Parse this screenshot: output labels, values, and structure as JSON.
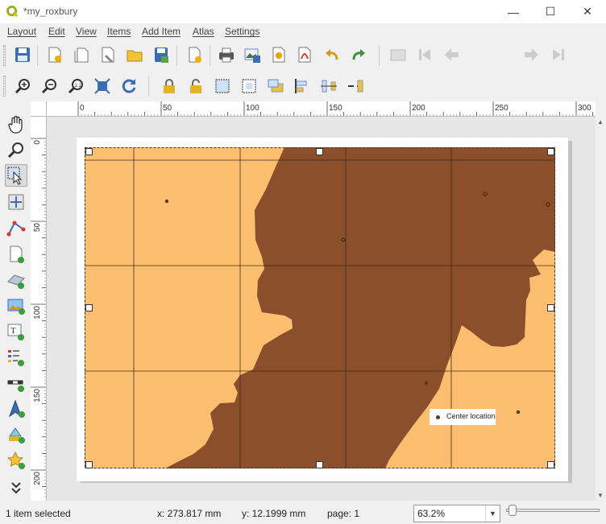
{
  "window": {
    "title": "*my_roxbury",
    "controls": {
      "minimize": "—",
      "maximize": "☐",
      "close": "✕"
    }
  },
  "menu": [
    "Layout",
    "Edit",
    "View",
    "Items",
    "Add Item",
    "Atlas",
    "Settings"
  ],
  "atlas_toolbar": {
    "page_value": "1",
    "more": "»"
  },
  "rulers": {
    "horizontal_labels": [
      "0",
      "50",
      "100",
      "150",
      "200",
      "250",
      "300"
    ],
    "vertical_labels": [
      "0",
      "50",
      "100",
      "150",
      "200"
    ]
  },
  "map": {
    "colors": {
      "light": "#fdbf6f",
      "dark": "#8b4f2b",
      "grid": "#3a2a1a"
    },
    "legend_label": "Center location"
  },
  "status": {
    "selection": "1 item selected",
    "x": "x: 273.817 mm",
    "y": "y: 12.1999 mm",
    "page": "page: 1",
    "zoom": "63.2%"
  },
  "icons": {
    "toolbar1": [
      "save-icon",
      "new-layout-icon",
      "duplicate-layout-icon",
      "layout-manager-icon",
      "open-template-icon",
      "save-template-icon",
      "add-pages-icon",
      "print-icon",
      "export-image-icon",
      "export-svg-icon",
      "export-pdf-icon",
      "undo-icon",
      "redo-icon",
      "atlas-preview-icon",
      "first-feature-icon",
      "previous-feature-icon",
      "next-feature-icon",
      "last-feature-icon"
    ],
    "toolbar2": [
      "zoom-in-icon",
      "zoom-out-icon",
      "zoom-100-icon",
      "zoom-full-icon",
      "refresh-icon",
      "lock-items-icon",
      "unlock-items-icon",
      "select-all-icon",
      "deselect-icon",
      "raise-items-icon",
      "align-items-icon",
      "distribute-items-icon",
      "resize-items-icon"
    ],
    "lefttools": [
      "pan-icon",
      "zoom-tool-icon",
      "select-move-icon",
      "move-content-icon",
      "edit-nodes-icon",
      "add-page-icon",
      "add-3d-map-icon",
      "add-picture-icon",
      "add-label-icon",
      "add-legend-icon",
      "add-scalebar-icon",
      "add-north-arrow-icon",
      "add-shape-icon",
      "add-marker-icon",
      "expand-tools-icon"
    ]
  }
}
